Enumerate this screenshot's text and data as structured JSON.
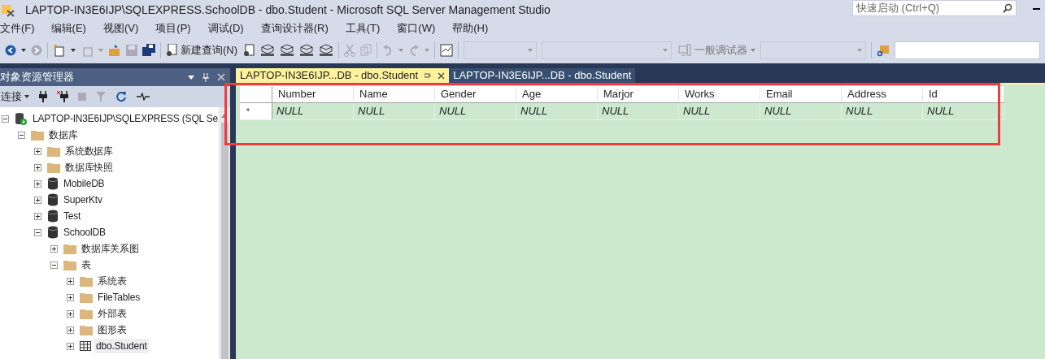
{
  "window": {
    "title": "LAPTOP-IN3E6IJP\\SQLEXPRESS.SchoolDB - dbo.Student - Microsoft SQL Server Management Studio"
  },
  "quick_launch": {
    "placeholder": "快速启动 (Ctrl+Q)"
  },
  "menu": [
    "文件(F)",
    "编辑(E)",
    "视图(V)",
    "项目(P)",
    "调试(D)",
    "查询设计器(R)",
    "工具(T)",
    "窗口(W)",
    "帮助(H)"
  ],
  "toolbar": {
    "new_query": "新建查询(N)",
    "debugger": "一般调试器"
  },
  "object_explorer": {
    "title": "对象资源管理器",
    "connect": "连接",
    "tree": [
      {
        "label": "LAPTOP-IN3E6IJP\\SQLEXPRESS (SQL Se",
        "kind": "server",
        "expanded": true,
        "selected": false,
        "children": [
          {
            "label": "数据库",
            "kind": "folder",
            "expanded": true,
            "selected": false,
            "children": [
              {
                "label": "系统数据库",
                "kind": "folder",
                "expanded": false,
                "selected": false
              },
              {
                "label": "数据库快照",
                "kind": "folder",
                "expanded": false,
                "selected": false
              },
              {
                "label": "MobileDB",
                "kind": "database",
                "expanded": false,
                "selected": false
              },
              {
                "label": "SuperKtv",
                "kind": "database",
                "expanded": false,
                "selected": false
              },
              {
                "label": "Test",
                "kind": "database",
                "expanded": false,
                "selected": false
              },
              {
                "label": "SchoolDB",
                "kind": "database",
                "expanded": true,
                "selected": false,
                "children": [
                  {
                    "label": "数据库关系图",
                    "kind": "folder",
                    "expanded": false,
                    "selected": false
                  },
                  {
                    "label": "表",
                    "kind": "folder",
                    "expanded": true,
                    "selected": false,
                    "children": [
                      {
                        "label": "系统表",
                        "kind": "folder",
                        "expanded": false,
                        "selected": false
                      },
                      {
                        "label": "FileTables",
                        "kind": "folder",
                        "expanded": false,
                        "selected": false
                      },
                      {
                        "label": "外部表",
                        "kind": "folder",
                        "expanded": false,
                        "selected": false
                      },
                      {
                        "label": "图形表",
                        "kind": "folder",
                        "expanded": false,
                        "selected": false
                      },
                      {
                        "label": "dbo.Student",
                        "kind": "table",
                        "expanded": false,
                        "selected": true
                      }
                    ]
                  }
                ]
              }
            ]
          }
        ]
      }
    ]
  },
  "tabs": [
    {
      "label": "LAPTOP-IN3E6IJP...DB - dbo.Student",
      "selected": true
    },
    {
      "label": "LAPTOP-IN3E6IJP...DB - dbo.Student",
      "selected": false
    }
  ],
  "grid": {
    "row_marker": "*",
    "columns": [
      "Number",
      "Name",
      "Gender",
      "Age",
      "Marjor",
      "Works",
      "Email",
      "Address",
      "Id"
    ],
    "rows": [
      [
        "NULL",
        "NULL",
        "NULL",
        "NULL",
        "NULL",
        "NULL",
        "NULL",
        "NULL",
        "NULL"
      ]
    ]
  }
}
